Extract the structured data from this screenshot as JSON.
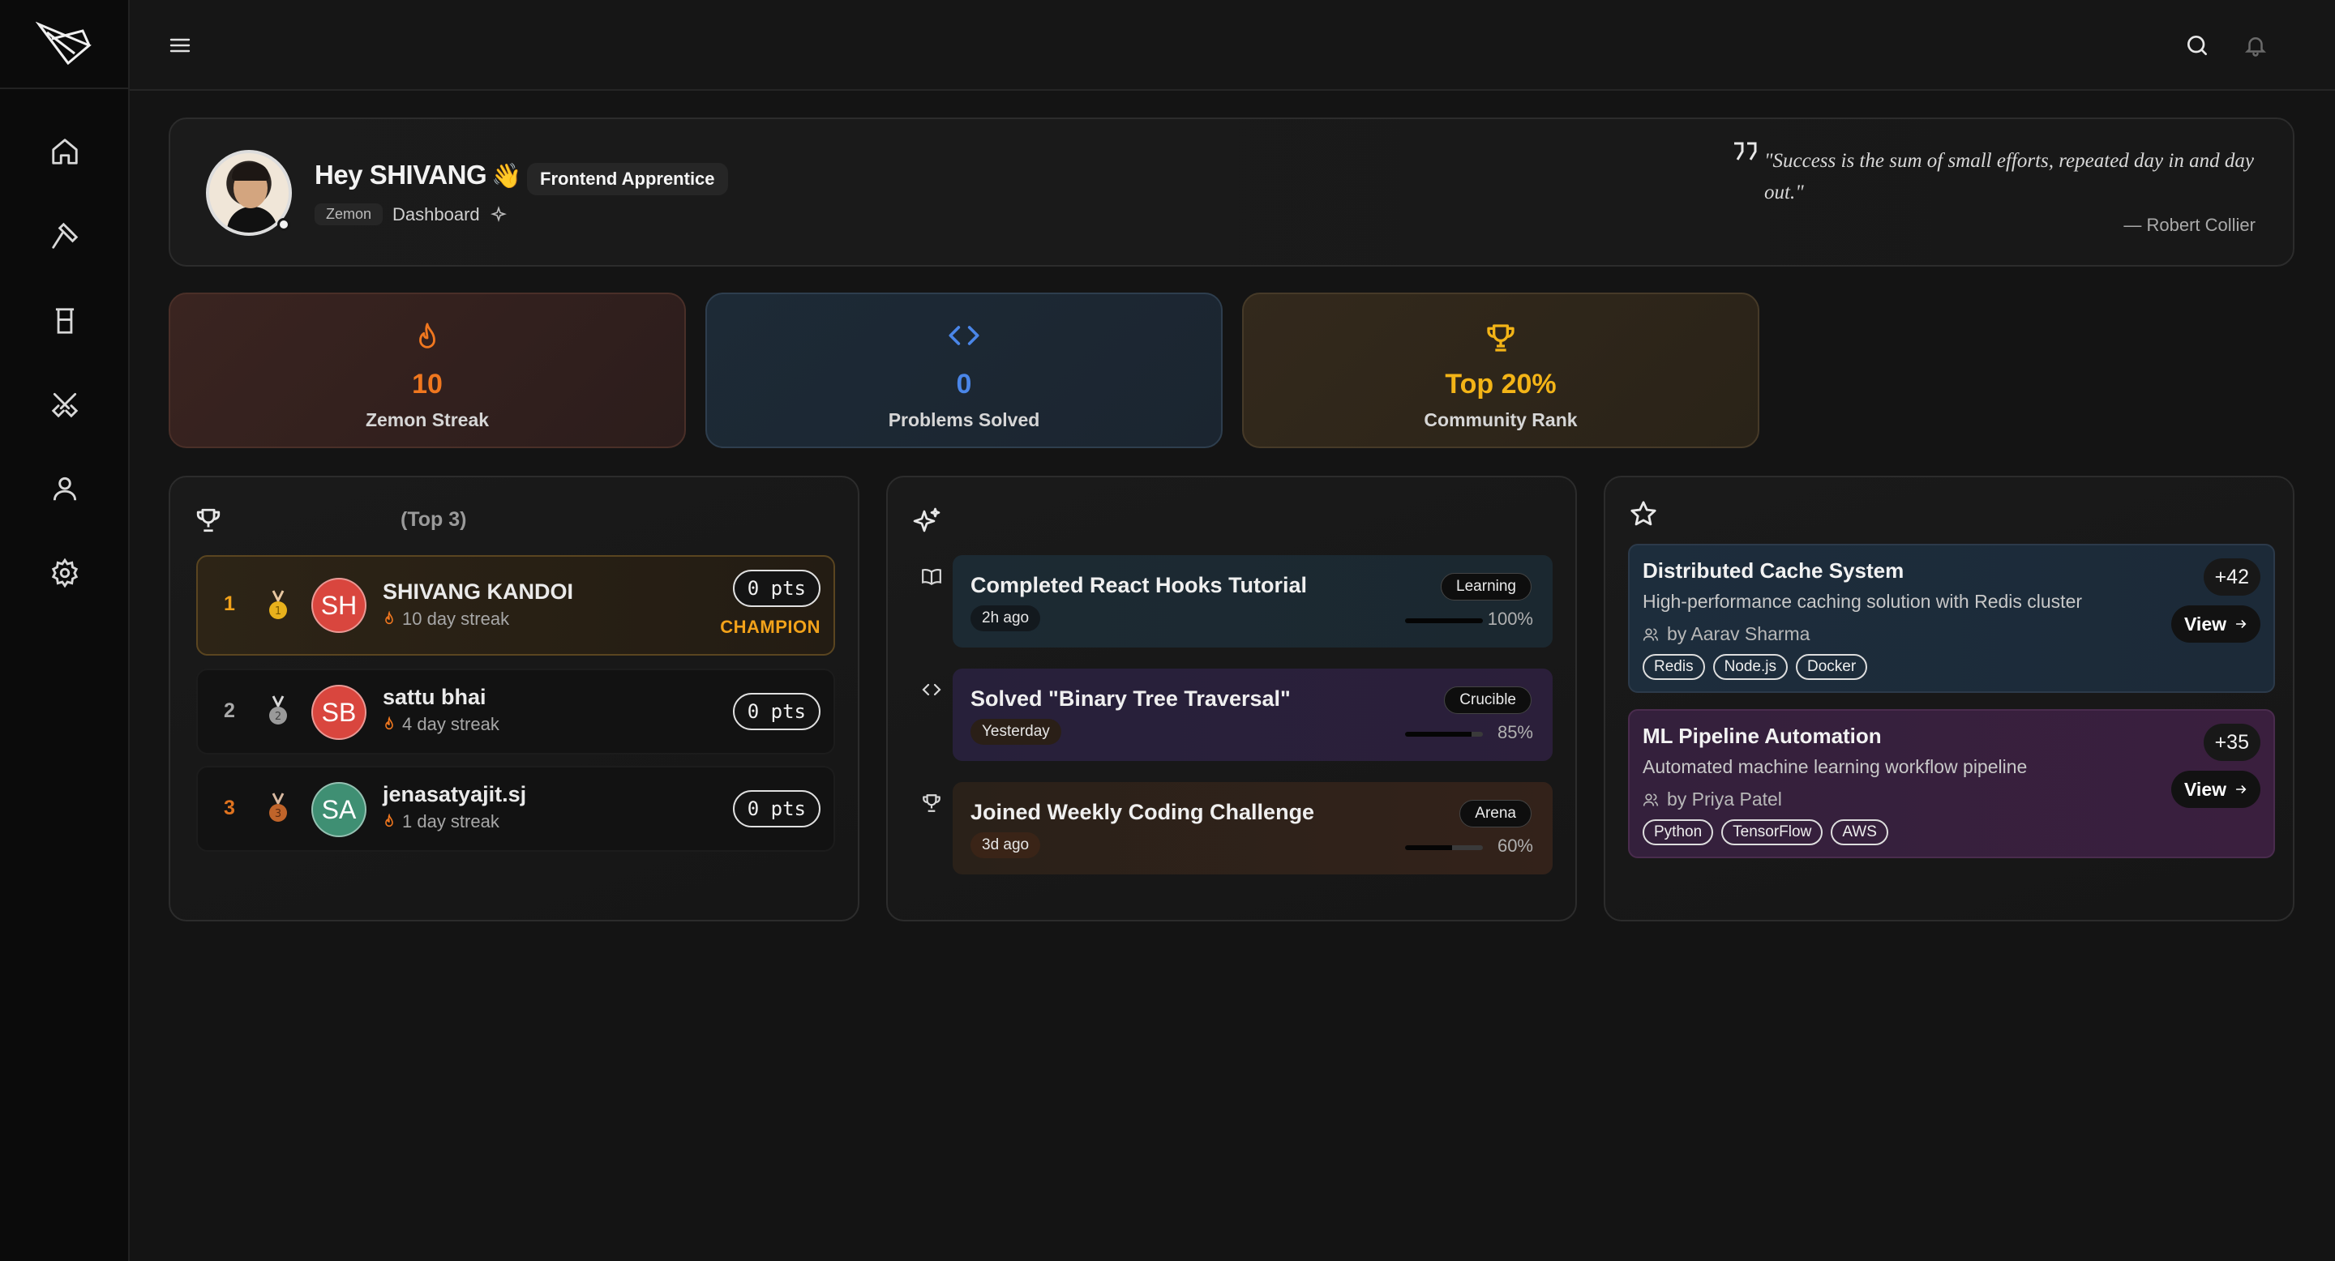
{
  "header": {
    "greeting": "Hey SHIVANG",
    "wave": "👋",
    "role_badge": "Frontend Apprentice",
    "crumb_app": "Zemon",
    "crumb_page": "Dashboard",
    "quote": "\"Success is the sum of small efforts, repeated day in and day out.\"",
    "quote_author": "— Robert Collier"
  },
  "stats": [
    {
      "value": "10",
      "label": "Zemon Streak",
      "color": "#f0771f",
      "icon": "flame-icon"
    },
    {
      "value": "0",
      "label": "Problems Solved",
      "color": "#4a86e8",
      "icon": "code-icon"
    },
    {
      "value": "Top 20%",
      "label": "Community Rank",
      "color": "#f3b417",
      "icon": "trophy-icon"
    }
  ],
  "leaderboard": {
    "title": "(Top 3)",
    "rows": [
      {
        "rank": "1",
        "initials": "SH",
        "name": "SHIVANG KANDOI",
        "streak": "10 day streak",
        "points": "0 pts",
        "tag": "CHAMPION",
        "avatar_color": "#d9463e",
        "rank_color": "#f2a21a",
        "medal_color": "#e8b11c"
      },
      {
        "rank": "2",
        "initials": "SB",
        "name": "sattu bhai",
        "streak": "4 day streak",
        "points": "0 pts",
        "avatar_color": "#d9463e",
        "rank_color": "#aaaaaa",
        "medal_color": "#9a9a9a"
      },
      {
        "rank": "3",
        "initials": "SA",
        "name": "jenasatyajit.sj",
        "streak": "1 day streak",
        "points": "0 pts",
        "avatar_color": "#3f8f73",
        "rank_color": "#e0731f",
        "medal_color": "#c0642a"
      }
    ]
  },
  "activity": [
    {
      "title": "Completed React Hooks Tutorial",
      "time": "2h ago",
      "category": "Learning",
      "progress": 100,
      "progress_label": "100%",
      "icon": "book-icon"
    },
    {
      "title": "Solved \"Binary Tree Traversal\"",
      "time": "Yesterday",
      "category": "Crucible",
      "progress": 85,
      "progress_label": "85%",
      "icon": "code-icon"
    },
    {
      "title": "Joined Weekly Coding Challenge",
      "time": "3d ago",
      "category": "Arena",
      "progress": 60,
      "progress_label": "60%",
      "icon": "trophy-icon"
    }
  ],
  "projects": [
    {
      "title": "Distributed Cache System",
      "description": "High-performance caching solution with Redis cluster",
      "author": "by Aarav Sharma",
      "score": "+42",
      "view_label": "View",
      "tags": [
        "Redis",
        "Node.js",
        "Docker"
      ]
    },
    {
      "title": "ML Pipeline Automation",
      "description": "Automated machine learning workflow pipeline",
      "author": "by Priya Patel",
      "score": "+35",
      "view_label": "View",
      "tags": [
        "Python",
        "TensorFlow",
        "AWS"
      ]
    }
  ]
}
